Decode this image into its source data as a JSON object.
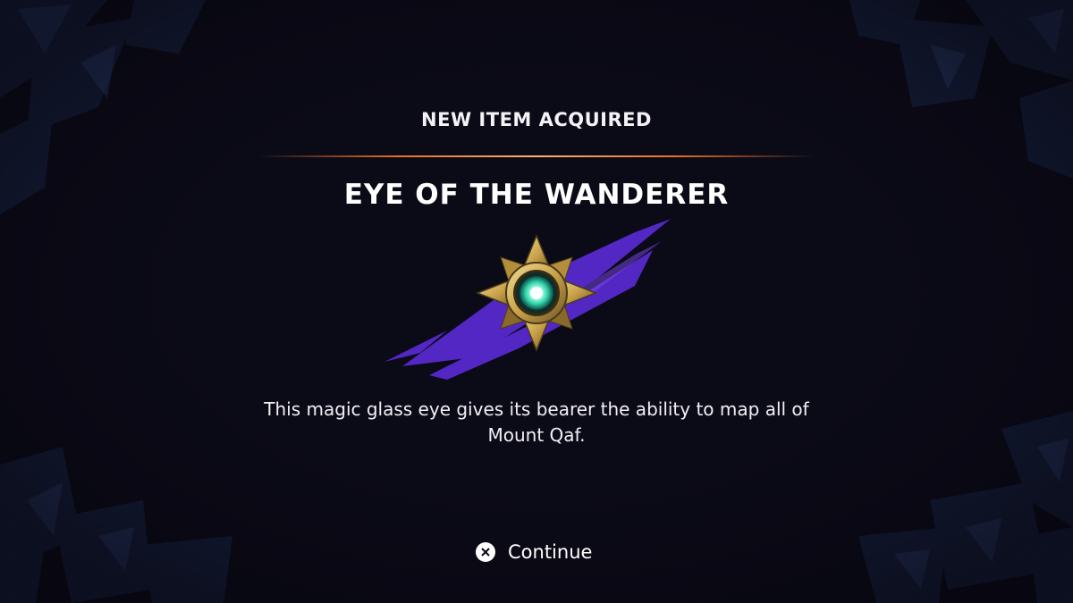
{
  "screen": {
    "header": "NEW ITEM ACQUIRED",
    "item_name": "EYE OF THE WANDERER",
    "item_description": "This magic glass eye gives its bearer the ability to map all of Mount Qaf.",
    "item_icon": "star-eye-amulet-icon"
  },
  "prompt": {
    "button_icon": "cross-button-icon",
    "label": "Continue"
  },
  "colors": {
    "background": "#0b0a17",
    "divider_accent": "#ff7a2a",
    "brush_purple": "#5a2bd6",
    "gold": "#c9a24a",
    "gem_glow": "#7fffe0",
    "shards": "#1a2544"
  }
}
